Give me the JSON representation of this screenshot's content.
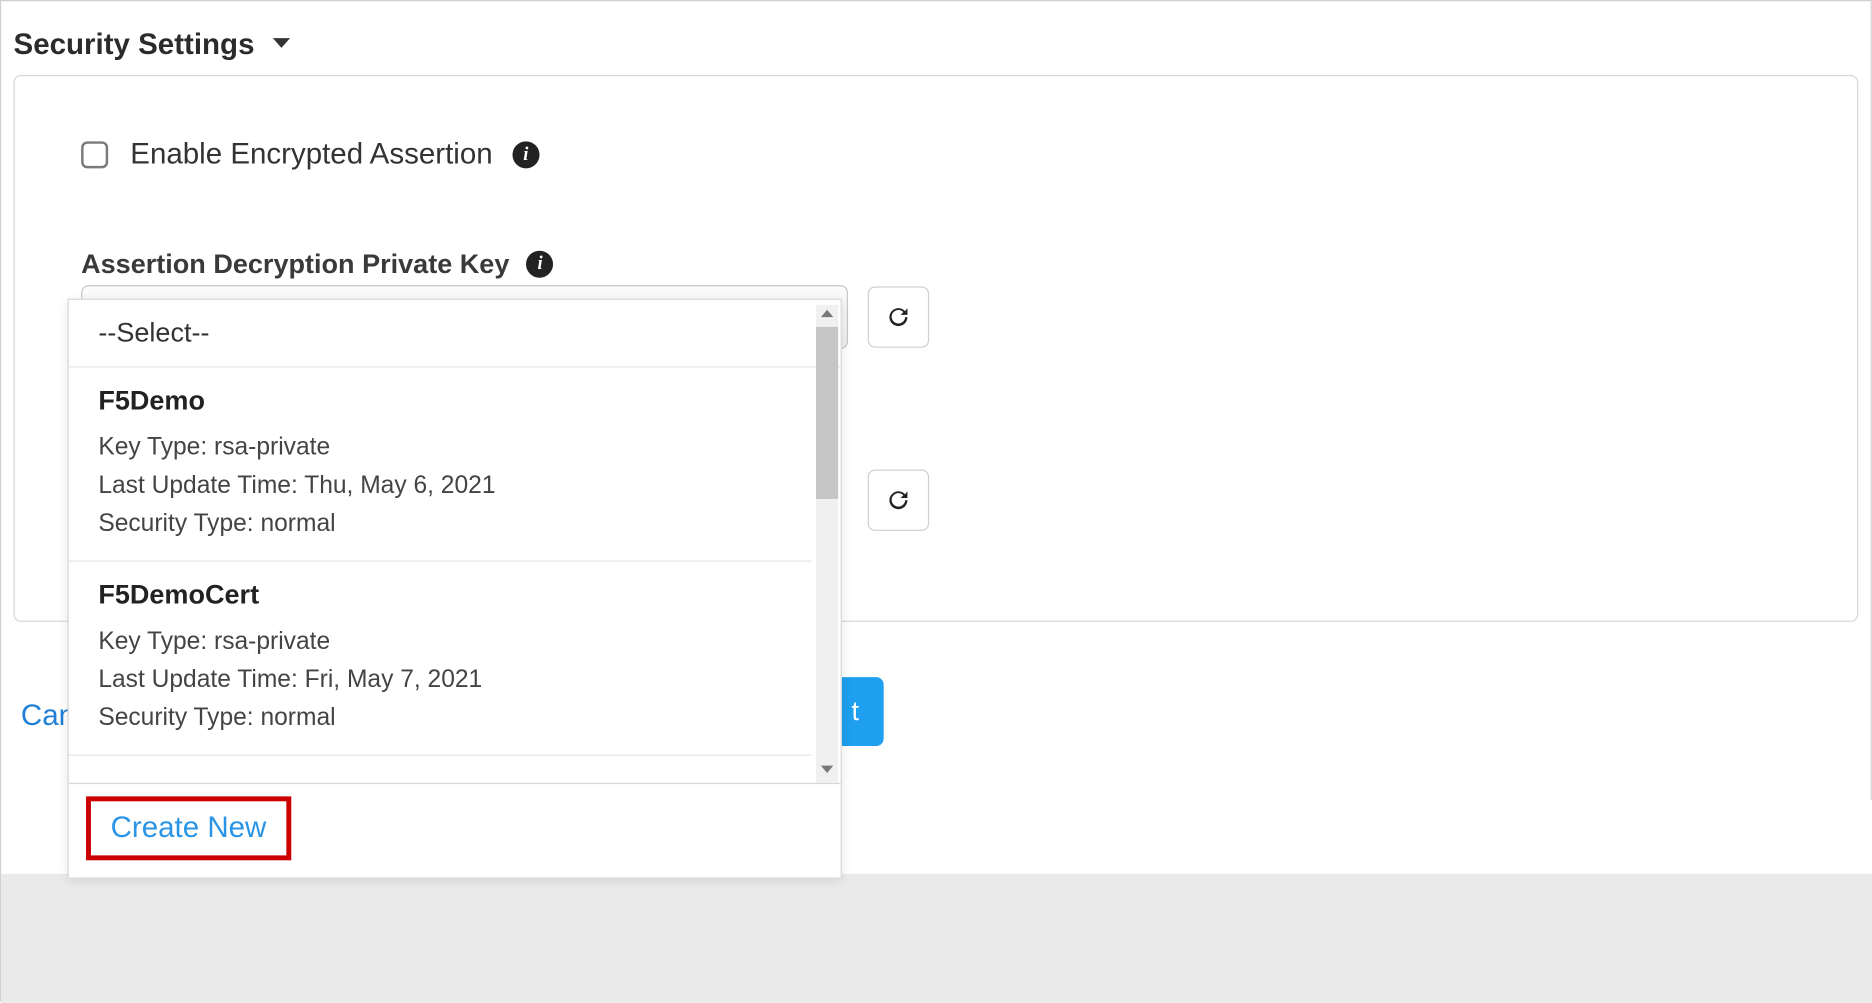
{
  "section": {
    "title": "Security Settings"
  },
  "checkbox": {
    "enableEncrypted": "Enable Encrypted Assertion"
  },
  "field": {
    "label": "Assertion Decryption Private Key"
  },
  "select": {
    "value": "Create New"
  },
  "dropdown": {
    "placeholder": "--Select--",
    "items": [
      {
        "name": "F5Demo",
        "keyTypeLabel": "Key Type:",
        "keyType": "rsa-private",
        "lastUpdateLabel": "Last Update Time:",
        "lastUpdate": "Thu, May 6, 2021",
        "securityTypeLabel": "Security Type:",
        "securityType": "normal"
      },
      {
        "name": "F5DemoCert",
        "keyTypeLabel": "Key Type:",
        "keyType": "rsa-private",
        "lastUpdateLabel": "Last Update Time:",
        "lastUpdate": "Fri, May 7, 2021",
        "securityTypeLabel": "Security Type:",
        "securityType": "normal"
      }
    ],
    "createNew": "Create New"
  },
  "footer": {
    "cancel": "Can",
    "nextFragment": "t"
  }
}
